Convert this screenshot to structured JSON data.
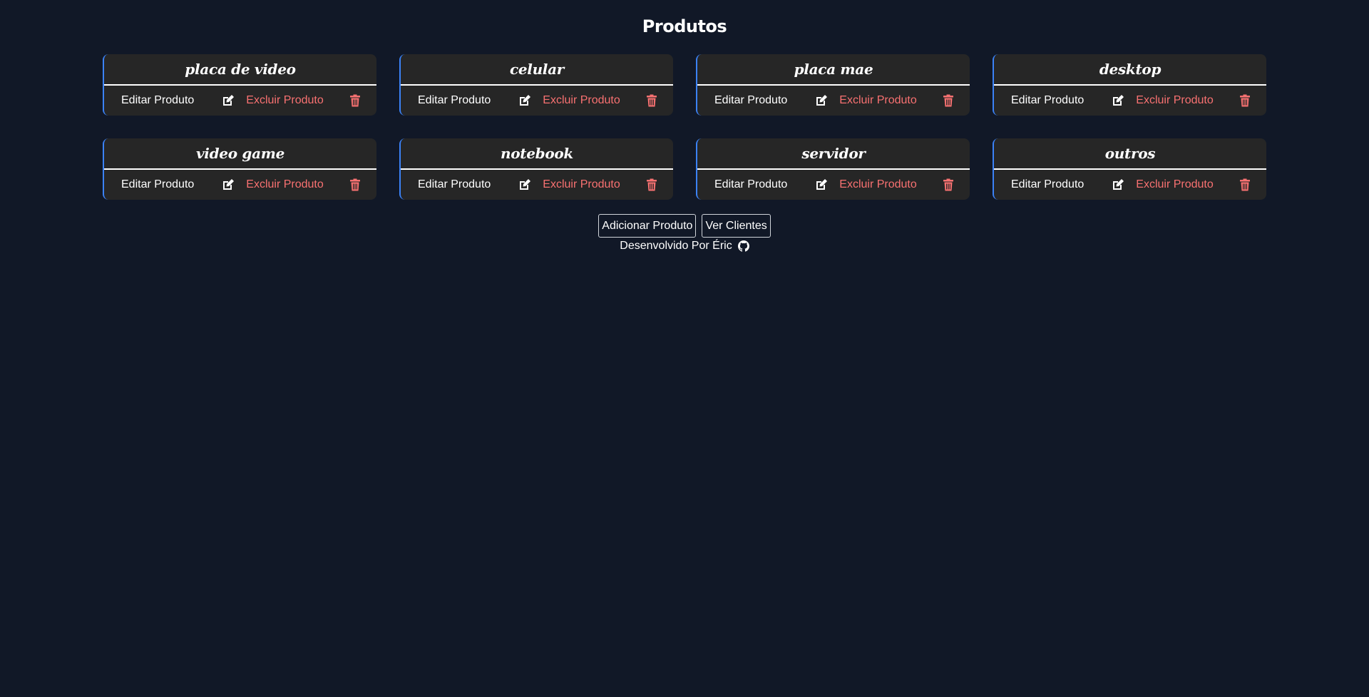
{
  "page": {
    "title": "Produtos"
  },
  "products": [
    {
      "name": "placa de video",
      "edit_label": "Editar Produto",
      "delete_label": "Excluir Produto"
    },
    {
      "name": "celular",
      "edit_label": "Editar Produto",
      "delete_label": "Excluir Produto"
    },
    {
      "name": "placa mae",
      "edit_label": "Editar Produto",
      "delete_label": "Excluir Produto"
    },
    {
      "name": "desktop",
      "edit_label": "Editar Produto",
      "delete_label": "Excluir Produto"
    },
    {
      "name": "video game",
      "edit_label": "Editar Produto",
      "delete_label": "Excluir Produto"
    },
    {
      "name": "notebook",
      "edit_label": "Editar Produto",
      "delete_label": "Excluir Produto"
    },
    {
      "name": "servidor",
      "edit_label": "Editar Produto",
      "delete_label": "Excluir Produto"
    },
    {
      "name": "outros",
      "edit_label": "Editar Produto",
      "delete_label": "Excluir Produto"
    }
  ],
  "actions": {
    "add_product_label": "Adicionar Produto",
    "view_clients_label": "Ver Clientes"
  },
  "footer": {
    "text": "Desenvolvido Por Éric",
    "icon": "github-icon"
  },
  "colors": {
    "background": "#111827",
    "card_background": "#262626",
    "card_accent": "#3b82f6",
    "delete_color": "#f87171",
    "text": "#ffffff"
  }
}
